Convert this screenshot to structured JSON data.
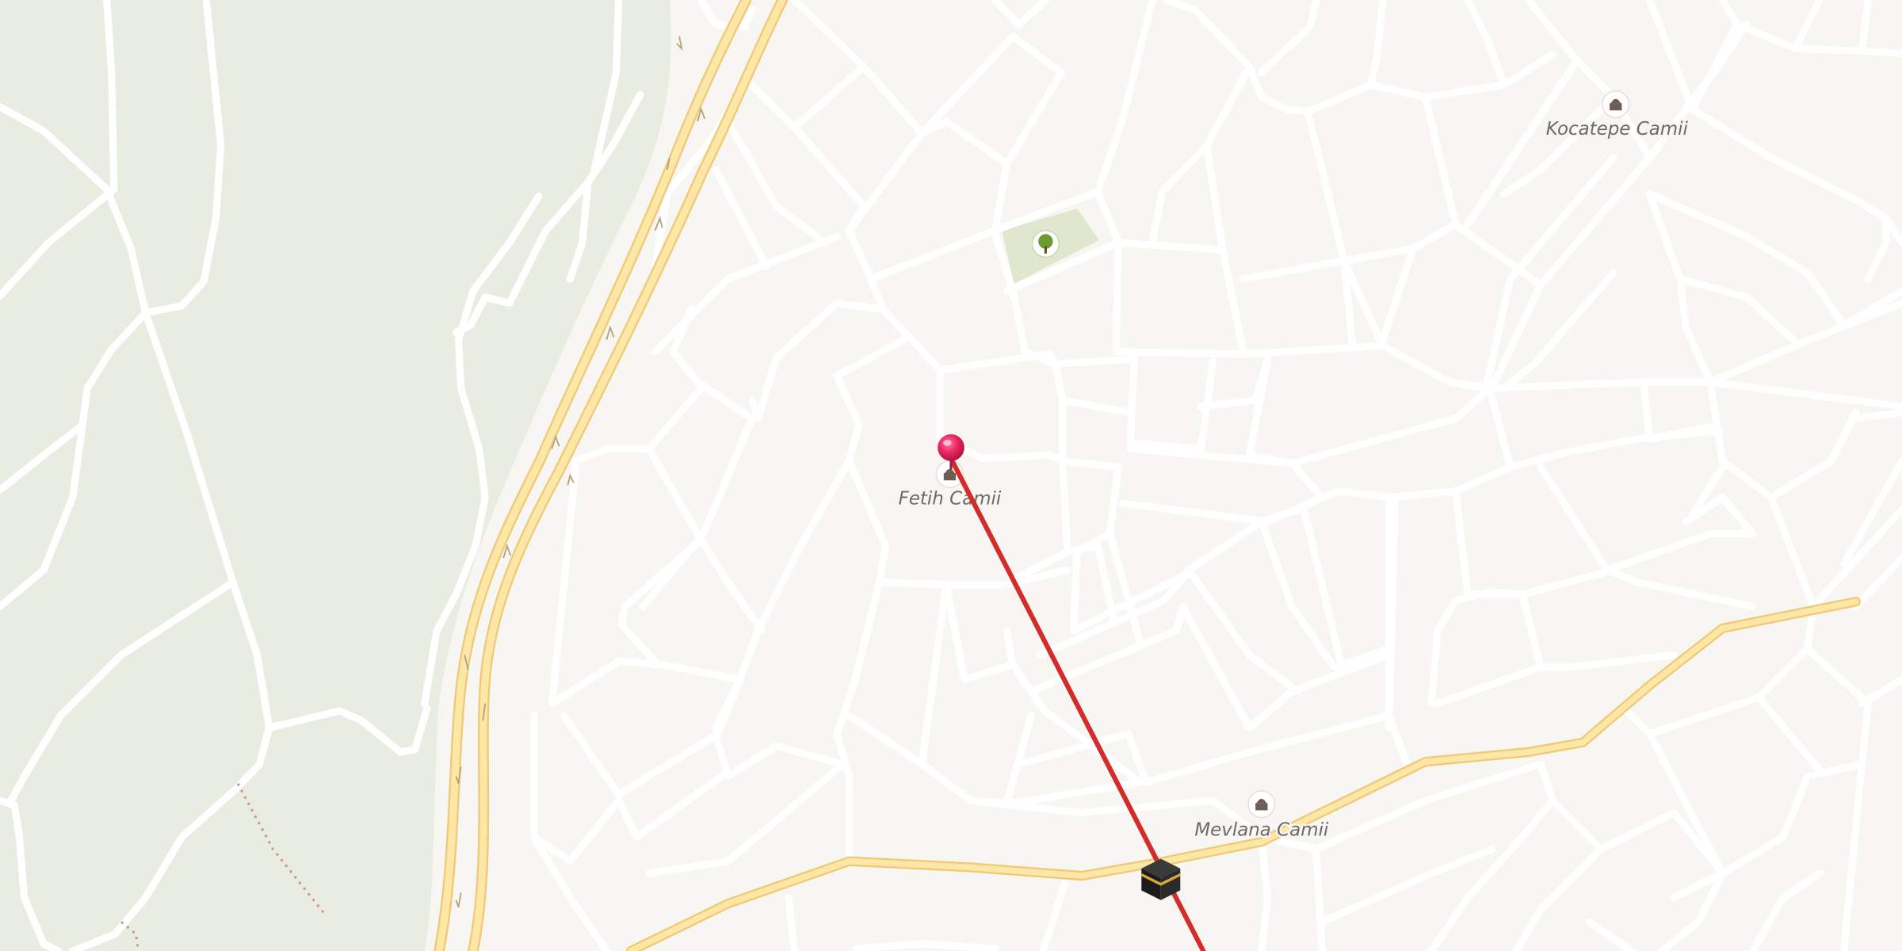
{
  "map": {
    "poi_labels": {
      "fetih_camii": "Fetih Camii",
      "kocatepe_camii": "Kocatepe Camii",
      "mevlana_camii": "Mevlana Camii"
    },
    "icons": {
      "location_pin": "location-pin-icon",
      "mosque": "mosque-icon",
      "park": "tree-icon",
      "kaaba": "kaaba-icon",
      "one_way_arrow": "one-way-arrow-icon"
    },
    "colors": {
      "background": "#f8f6f3",
      "park_area": "#e9ede1",
      "road_minor": "#ffffff",
      "road_major_fill": "#fde7a6",
      "road_major_casing": "#f0c977",
      "qibla_line": "#d42b2b",
      "pin": "#e8245f",
      "poi_text": "#6d6a66"
    }
  }
}
